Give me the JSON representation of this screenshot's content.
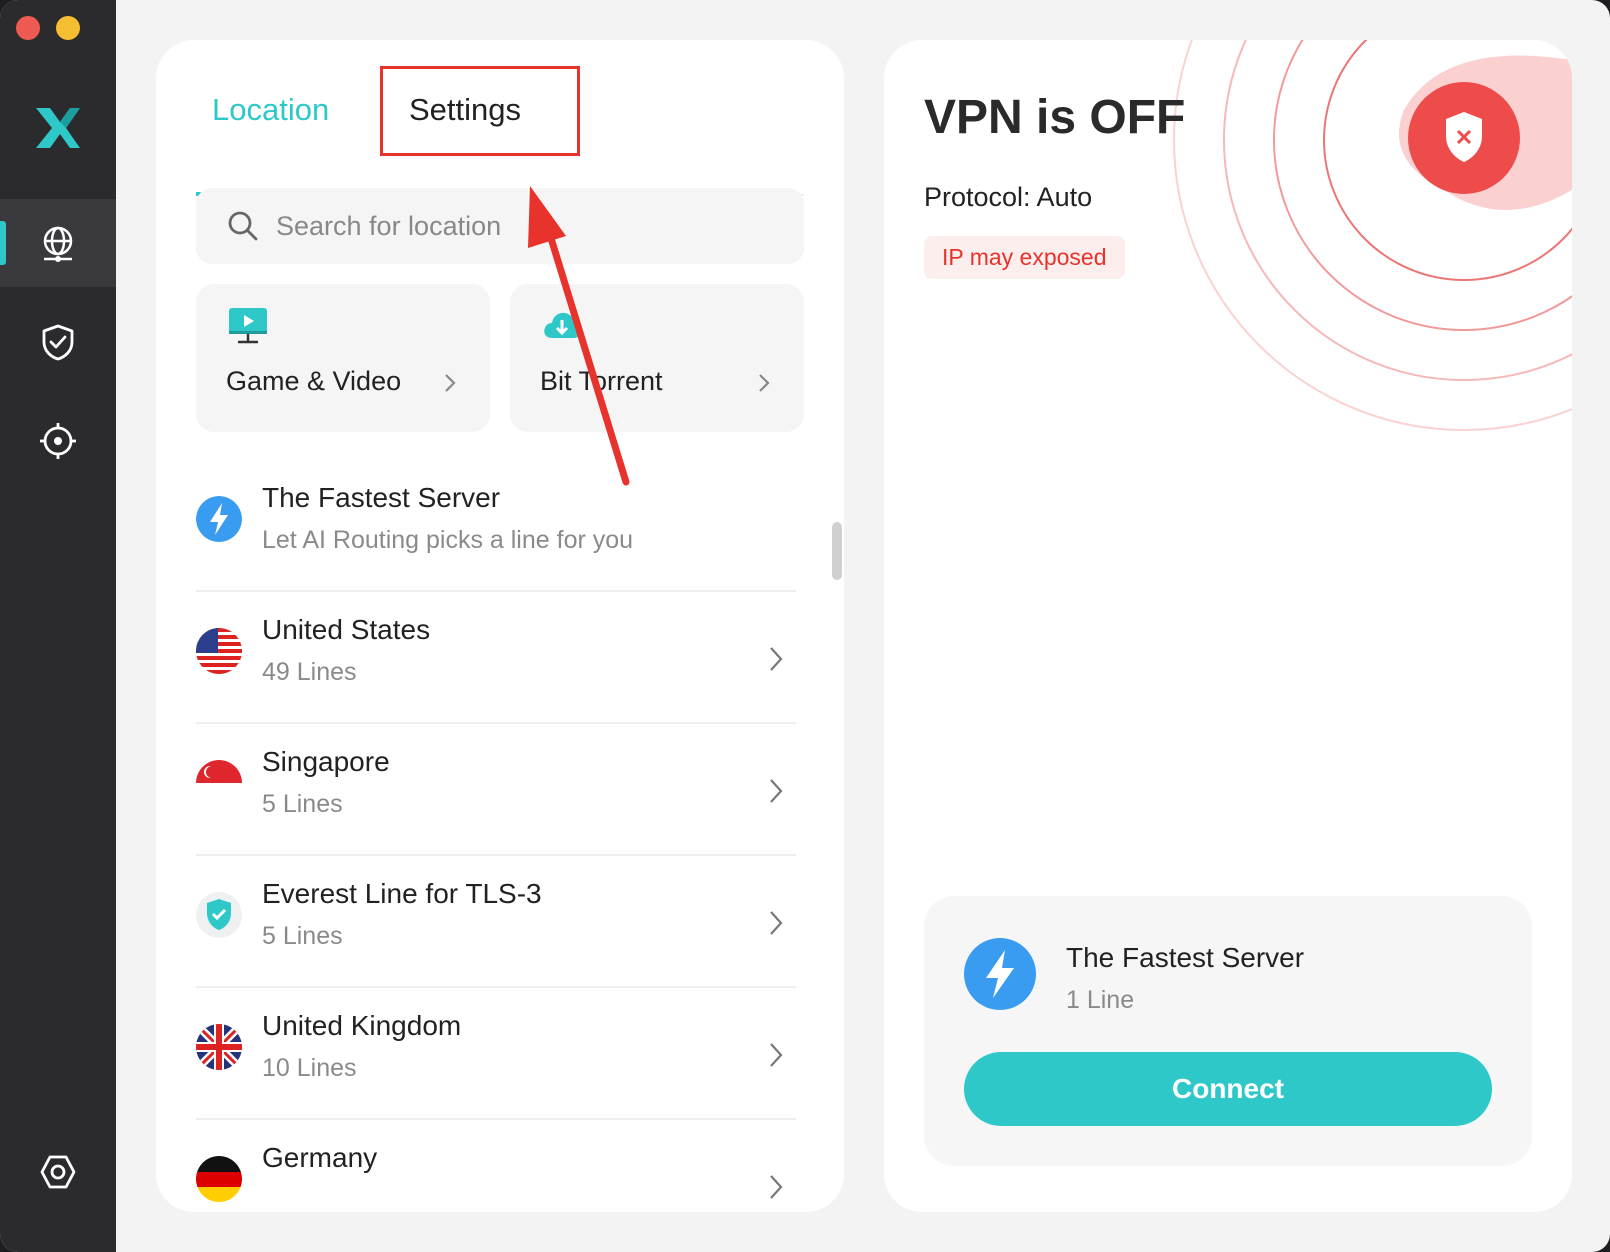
{
  "tabs": {
    "location": "Location",
    "settings": "Settings"
  },
  "search": {
    "placeholder": "Search for location"
  },
  "quick": [
    {
      "label": "Game & Video",
      "icon": "monitor-play-icon"
    },
    {
      "label": "Bit Torrent",
      "icon": "cloud-download-icon"
    }
  ],
  "list": [
    {
      "title": "The Fastest Server",
      "sub": "Let AI Routing picks a line for you",
      "icon": "lightning-icon"
    },
    {
      "title": "United States",
      "sub": "49 Lines",
      "icon": "us-flag-icon"
    },
    {
      "title": "Singapore",
      "sub": "5 Lines",
      "icon": "sg-flag-icon"
    },
    {
      "title": "Everest Line for TLS-3",
      "sub": "5 Lines",
      "icon": "shield-check-icon"
    },
    {
      "title": "United Kingdom",
      "sub": "10 Lines",
      "icon": "uk-flag-icon"
    },
    {
      "title": "Germany",
      "sub": "",
      "icon": "de-flag-icon"
    }
  ],
  "status": {
    "title": "VPN is OFF",
    "protocol": "Protocol: Auto",
    "ip_warning": "IP may exposed"
  },
  "server_card": {
    "title": "The Fastest Server",
    "sub": "1 Line",
    "connect": "Connect"
  },
  "colors": {
    "accent": "#2ec8c8",
    "danger": "#e8322c",
    "sidebar": "#2b2b2e"
  }
}
